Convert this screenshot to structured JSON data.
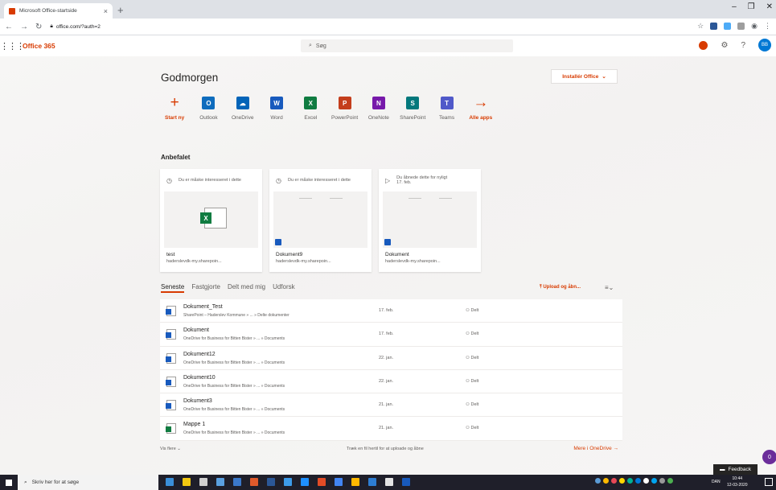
{
  "browser": {
    "tab_title": "Microsoft Office-startside",
    "url": "office.com/?auth=2",
    "new_tab_icon": "+",
    "close_icon": "×"
  },
  "header": {
    "brand": "Office 365",
    "search_placeholder": "Søg",
    "avatar_initials": "BB"
  },
  "main": {
    "greeting": "Godmorgen",
    "install_button": "Installér Office",
    "apps": [
      {
        "label": "Start ny",
        "icon": "plus-icon",
        "color": "#d83b01",
        "glyph": "+",
        "accent": true
      },
      {
        "label": "Outlook",
        "icon": "outlook-icon",
        "color": "#0f6cbd",
        "glyph": "O"
      },
      {
        "label": "OneDrive",
        "icon": "onedrive-icon",
        "color": "#0364b8",
        "glyph": "☁"
      },
      {
        "label": "Word",
        "icon": "word-icon",
        "color": "#185abd",
        "glyph": "W"
      },
      {
        "label": "Excel",
        "icon": "excel-icon",
        "color": "#107c41",
        "glyph": "X"
      },
      {
        "label": "PowerPoint",
        "icon": "powerpoint-icon",
        "color": "#c43e1c",
        "glyph": "P"
      },
      {
        "label": "OneNote",
        "icon": "onenote-icon",
        "color": "#7719aa",
        "glyph": "N"
      },
      {
        "label": "SharePoint",
        "icon": "sharepoint-icon",
        "color": "#03787c",
        "glyph": "S"
      },
      {
        "label": "Teams",
        "icon": "teams-icon",
        "color": "#5059c9",
        "glyph": "T"
      },
      {
        "label": "Alle apps",
        "icon": "arrow-right-icon",
        "color": "#d83b01",
        "glyph": "→",
        "accent": true
      }
    ],
    "recommended_title": "Anbefalet",
    "cards": [
      {
        "reason": "Du er måske interesseret i dette",
        "name": "test",
        "location": "haderslevdk-my.sharepoin...",
        "type": "excel"
      },
      {
        "reason": "Du er måske interesseret i dette",
        "name": "Dokument9",
        "location": "haderslevdk-my.sharepoin...",
        "type": "word"
      },
      {
        "reason": "Du åbnede dette for nyligt",
        "reason_date": "17. feb.",
        "name": "Dokument",
        "location": "haderslevdk-my.sharepoin...",
        "type": "word"
      }
    ],
    "tabs": [
      "Seneste",
      "Fastgjorte",
      "Delt med mig",
      "Udforsk"
    ],
    "upload_label": "Upload og åbn...",
    "files": [
      {
        "name": "Dokument_Test",
        "path": "SharePoint – Haderslev Kommune » ... » Delte dokumenter",
        "date": "17. feb.",
        "share": "Delt",
        "type": "word"
      },
      {
        "name": "Dokument",
        "path": "OneDrive for Business for Bitten Bister » ... » Documents",
        "date": "17. feb.",
        "share": "Delt",
        "type": "word"
      },
      {
        "name": "Dokument12",
        "path": "OneDrive for Business for Bitten Bister » ... » Documents",
        "date": "22. jan.",
        "share": "Delt",
        "type": "word"
      },
      {
        "name": "Dokument10",
        "path": "OneDrive for Business for Bitten Bister » ... » Documents",
        "date": "22. jan.",
        "share": "Delt",
        "type": "word"
      },
      {
        "name": "Dokument3",
        "path": "OneDrive for Business for Bitten Bister » ... » Documents",
        "date": "21. jan.",
        "share": "Delt",
        "type": "word"
      },
      {
        "name": "Mappe 1",
        "path": "OneDrive for Business for Bitten Bister » ... » Documents",
        "date": "21. jan.",
        "share": "Delt",
        "type": "excel"
      }
    ],
    "show_more": "Vis flere",
    "drag_hint": "Træk en fil hertil for at uploade og åbne",
    "more_onedrive": "Mere i OneDrive",
    "feedback_label": "Feedback",
    "help_badge": "0"
  },
  "taskbar": {
    "search_placeholder": "Skriv her for at søge",
    "lang": "DAN",
    "time": "10:44",
    "date": "12-03-2020",
    "app_colors": [
      "#3a8fd9",
      "#f2c811",
      "#d0d0d0",
      "#5aa0e0",
      "#3b78c9",
      "#e05a2b",
      "#2b5797",
      "#3d9be9",
      "#1e90ff",
      "#e34c26",
      "#4285f4",
      "#ffb900",
      "#2d7dd2",
      "#e3e3e3",
      "#185abd"
    ],
    "tray_colors": [
      "#5b9bd5",
      "#ffb900",
      "#e74856",
      "#ffd700",
      "#00b294",
      "#0078d7",
      "#ffffff",
      "#00a4ef",
      "#999999",
      "#4caf50"
    ]
  }
}
